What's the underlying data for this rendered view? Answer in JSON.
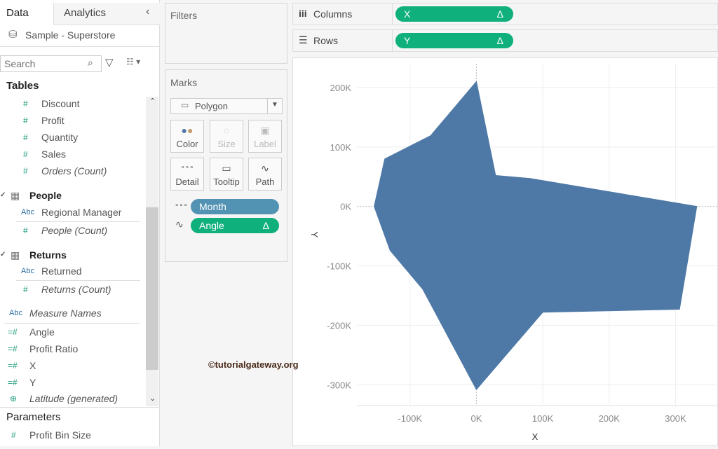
{
  "left_panel": {
    "tabs": [
      "Data",
      "Analytics"
    ],
    "collapse_icon": "chevron-left-icon",
    "datasource": "Sample - Superstore",
    "search_placeholder": "Search",
    "tables_header": "Tables",
    "orders_fields": [
      {
        "label": "Discount",
        "type": "measure",
        "italic": false
      },
      {
        "label": "Profit",
        "type": "measure",
        "italic": false
      },
      {
        "label": "Quantity",
        "type": "measure",
        "italic": false
      },
      {
        "label": "Sales",
        "type": "measure",
        "italic": false
      },
      {
        "label": "Orders (Count)",
        "type": "measure",
        "italic": true
      }
    ],
    "people": {
      "name": "People",
      "fields": [
        {
          "label": "Regional Manager",
          "type": "dimension"
        },
        {
          "label": "People (Count)",
          "type": "measure"
        }
      ]
    },
    "returns": {
      "name": "Returns",
      "fields": [
        {
          "label": "Returned",
          "type": "dimension"
        },
        {
          "label": "Returns (Count)",
          "type": "measure"
        }
      ]
    },
    "measure_names": "Measure Names",
    "calc_fields": [
      "Angle",
      "Profit Ratio",
      "X",
      "Y"
    ],
    "latitude": "Latitude (generated)",
    "parameters_header": "Parameters",
    "parameters": [
      "Profit Bin Size"
    ],
    "abc": "Abc"
  },
  "filters": {
    "title": "Filters"
  },
  "marks": {
    "title": "Marks",
    "type": "Polygon",
    "buttons": [
      "Color",
      "Size",
      "Label",
      "Detail",
      "Tooltip",
      "Path"
    ],
    "pills": [
      {
        "label": "Month",
        "color": "#5293b4"
      },
      {
        "label": "Angle",
        "color": "#0fb07b",
        "delta": "Δ"
      }
    ]
  },
  "shelves": {
    "columns_label": "Columns",
    "rows_label": "Rows",
    "columns_pill": "X",
    "rows_pill": "Y",
    "delta": "Δ",
    "pill_color": "#0fb07b"
  },
  "watermark": "©tutorialgateway.org",
  "chart_data": {
    "type": "area",
    "mark": "polygon",
    "xlabel": "X",
    "ylabel": "Y",
    "xlim": [
      -180000,
      365000
    ],
    "ylim": [
      -335000,
      240000
    ],
    "x_ticks": [
      {
        "v": -100000,
        "label": "-100K"
      },
      {
        "v": 0,
        "label": "0K"
      },
      {
        "v": 100000,
        "label": "100K"
      },
      {
        "v": 200000,
        "label": "200K"
      },
      {
        "v": 300000,
        "label": "300K"
      }
    ],
    "y_ticks": [
      {
        "v": 200000,
        "label": "200K"
      },
      {
        "v": 100000,
        "label": "100K"
      },
      {
        "v": 0,
        "label": "0K"
      },
      {
        "v": -100000,
        "label": "-100K"
      },
      {
        "v": -200000,
        "label": "-200K"
      },
      {
        "v": -300000,
        "label": "-300K"
      }
    ],
    "grid": true,
    "color": "#4e79a7",
    "points": [
      [
        0,
        210000
      ],
      [
        -69000,
        119000
      ],
      [
        -138000,
        80000
      ],
      [
        -154000,
        0
      ],
      [
        -130000,
        -74000
      ],
      [
        -81000,
        -139000
      ],
      [
        0,
        -308000
      ],
      [
        100000,
        -178000
      ],
      [
        306000,
        -173000
      ],
      [
        332000,
        0
      ],
      [
        81000,
        47000
      ],
      [
        29000,
        52000
      ]
    ]
  }
}
